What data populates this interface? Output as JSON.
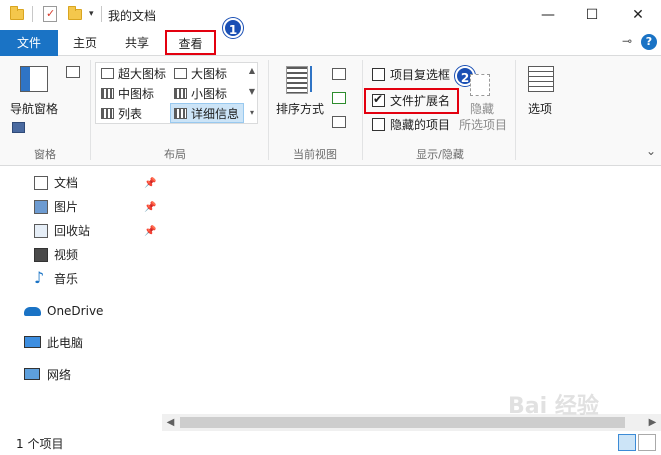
{
  "window": {
    "title": "我的文档",
    "controls": {
      "minimize": "—",
      "maximize": "☐",
      "close": "✕"
    }
  },
  "quick_access": {
    "dropdown": "▾"
  },
  "tabs": [
    {
      "label": "文件"
    },
    {
      "label": "主页"
    },
    {
      "label": "共享"
    },
    {
      "label": "查看"
    }
  ],
  "ribbon_controls": {
    "pin": "⊸",
    "collapse": "⌄",
    "help": "?"
  },
  "ribbon": {
    "panes": {
      "nav_pane_label": "导航窗格",
      "group_label": "窗格"
    },
    "layout": {
      "items": [
        {
          "label": "超大图标"
        },
        {
          "label": "大图标"
        },
        {
          "label": "中图标"
        },
        {
          "label": "小图标"
        },
        {
          "label": "列表"
        },
        {
          "label": "详细信息"
        }
      ],
      "group_label": "布局"
    },
    "current_view": {
      "sort_label": "排序方式",
      "group_label": "当前视图"
    },
    "show_hide": {
      "item_checkboxes": {
        "label": "项目复选框",
        "checked": false
      },
      "file_extensions": {
        "label": "文件扩展名",
        "checked": true
      },
      "hidden_items": {
        "label": "隐藏的项目",
        "checked": false
      },
      "hide_selected_line1": "隐藏",
      "hide_selected_line2": "所选项目",
      "group_label": "显示/隐藏"
    },
    "options_label": "选项"
  },
  "markers": [
    "1",
    "2"
  ],
  "nav": {
    "items": [
      {
        "label": "文档",
        "pinned": true
      },
      {
        "label": "图片",
        "pinned": true
      },
      {
        "label": "回收站",
        "pinned": true
      },
      {
        "label": "视频",
        "pinned": false
      },
      {
        "label": "音乐",
        "pinned": false
      },
      {
        "label": "OneDrive",
        "pinned": false
      },
      {
        "label": "此电脑",
        "pinned": false
      },
      {
        "label": "网络",
        "pinned": false
      }
    ]
  },
  "status": {
    "item_count": "1 个项目"
  },
  "watermark": "Bai 经验",
  "colors": {
    "accent": "#1a73c5",
    "highlight_red": "#e3000f",
    "marker_blue": "#1a4fb4"
  }
}
